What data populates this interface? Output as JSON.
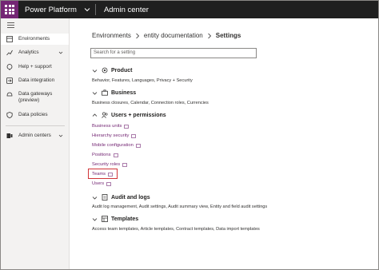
{
  "topbar": {
    "app_title": "Power Platform",
    "section_title": "Admin center"
  },
  "sidebar": {
    "items": [
      {
        "label": "Environments",
        "icon": "environments-icon"
      },
      {
        "label": "Analytics",
        "icon": "analytics-icon"
      },
      {
        "label": "Help + support",
        "icon": "help-support-icon"
      },
      {
        "label": "Data integration",
        "icon": "data-integration-icon"
      },
      {
        "label": "Data gateways (preview)",
        "label_line1": "Data gateways",
        "label_line2": "(preview)",
        "icon": "data-gateways-icon"
      },
      {
        "label": "Data policies",
        "icon": "data-policies-icon"
      },
      {
        "label": "Admin centers",
        "icon": "admin-centers-icon"
      }
    ]
  },
  "breadcrumb": {
    "items": [
      "Environments",
      "entity documentation",
      "Settings"
    ]
  },
  "search": {
    "placeholder": "Search for a setting"
  },
  "groups": {
    "product": {
      "title": "Product",
      "desc": "Behavior, Features, Languages, Privacy + Security"
    },
    "business": {
      "title": "Business",
      "desc": "Business closures, Calendar, Connection roles, Currencies"
    },
    "users_permissions": {
      "title": "Users + permissions",
      "links": [
        "Business units",
        "Hierarchy security",
        "Mobile configuration",
        "Positions",
        "Security roles",
        "Teams",
        "Users"
      ]
    },
    "audit_logs": {
      "title": "Audit and logs",
      "desc": "Audit log management, Audit settings, Audit summary view, Entity and field audit settings"
    },
    "templates": {
      "title": "Templates",
      "desc": "Access team templates, Article templates, Contract templates, Data import templates"
    }
  },
  "colors": {
    "brand": "#742774",
    "topbar": "#1f1f1f",
    "highlight": "#d13438"
  }
}
